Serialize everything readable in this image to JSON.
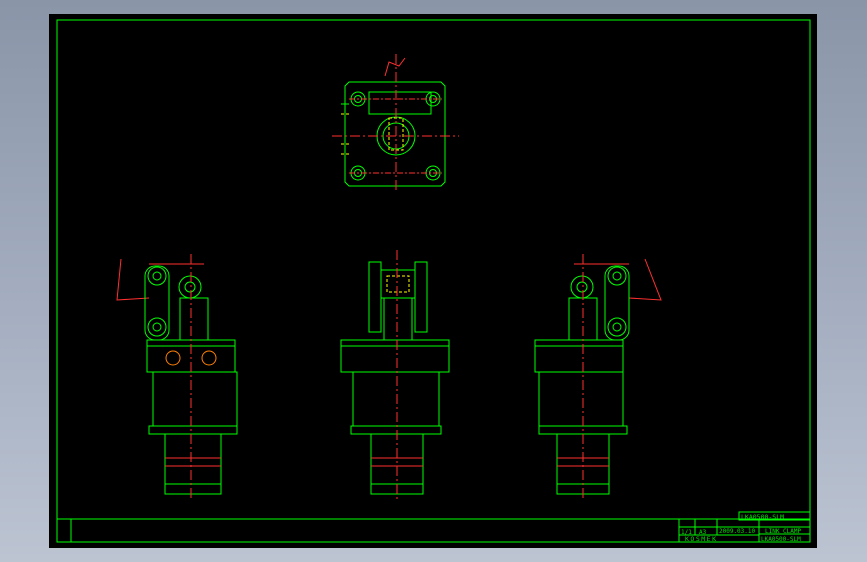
{
  "title_block": {
    "drawing_code": "LKA0500-SLM",
    "scale": "1/1",
    "sheet_size": "A3",
    "date": "2009.03.10",
    "product_name": "LINK CLAMP",
    "model_number": "LKA0500-SLM",
    "company": "KOSMEK"
  },
  "colors": {
    "outline": "#00ff00",
    "centerline": "#ff3030",
    "hidden": "#ffff00",
    "background": "#000000"
  }
}
